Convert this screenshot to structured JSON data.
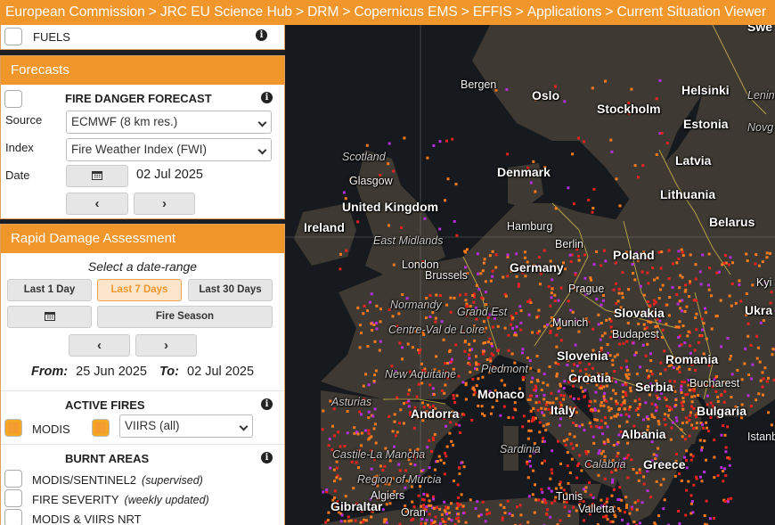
{
  "breadcrumb": [
    "European Commission",
    "JRC EU Science Hub",
    "DRM",
    "Copernicus EMS",
    "EFFIS",
    "Applications",
    "Current Situation Viewer"
  ],
  "fuels": {
    "label": "FUELS"
  },
  "forecasts": {
    "header": "Forecasts",
    "title": "FIRE DANGER FORECAST",
    "source_label": "Source",
    "source_value": "ECMWF (8 km res.)",
    "index_label": "Index",
    "index_value": "Fire Weather Index (FWI)",
    "date_label": "Date",
    "date_value": "02 Jul 2025",
    "prev": "‹",
    "next": "›"
  },
  "rda": {
    "header": "Rapid Damage Assessment",
    "select_range": "Select a date-range",
    "ranges": [
      "Last 1 Day",
      "Last 7 Days",
      "Last 30 Days"
    ],
    "active_range": "Last 7 Days",
    "fire_season": "Fire Season",
    "prev": "‹",
    "next": "›",
    "from_label": "From:",
    "from_value": "25 Jun 2025",
    "to_label": "To:",
    "to_value": "02 Jul 2025",
    "active_fires": {
      "title": "ACTIVE FIRES",
      "modis_label": "MODIS",
      "modis_checked": true,
      "viirs_checked": true,
      "viirs_value": "VIIRS (all)"
    },
    "burnt_areas": {
      "title": "BURNT AREAS",
      "items": [
        {
          "label": "MODIS/SENTINEL2",
          "note": "(supervised)"
        },
        {
          "label": "FIRE SEVERITY",
          "note": "(weekly updated)"
        },
        {
          "label": "MODIS & VIIRS NRT",
          "note": ""
        }
      ]
    }
  },
  "map": {
    "labels": [
      {
        "text": "Swe",
        "kind": "country"
      },
      {
        "text": "Bergen",
        "kind": "city"
      },
      {
        "text": "Oslo",
        "kind": "country"
      },
      {
        "text": "Helsinki",
        "kind": "country"
      },
      {
        "text": "Lenin",
        "kind": "region"
      },
      {
        "text": "Stockholm",
        "kind": "country"
      },
      {
        "text": "Estonia",
        "kind": "country"
      },
      {
        "text": "Novg",
        "kind": "region"
      },
      {
        "text": "Scotland",
        "kind": "region"
      },
      {
        "text": "Latvia",
        "kind": "country"
      },
      {
        "text": "Denmark",
        "kind": "country"
      },
      {
        "text": "Glasgow",
        "kind": "city"
      },
      {
        "text": "Lithuania",
        "kind": "country"
      },
      {
        "text": "United Kingdom",
        "kind": "country"
      },
      {
        "text": "Ireland",
        "kind": "country"
      },
      {
        "text": "Belarus",
        "kind": "country"
      },
      {
        "text": "Hamburg",
        "kind": "city"
      },
      {
        "text": "East Midlands",
        "kind": "region"
      },
      {
        "text": "Berlin",
        "kind": "city"
      },
      {
        "text": "London",
        "kind": "city"
      },
      {
        "text": "Poland",
        "kind": "country"
      },
      {
        "text": "Germany",
        "kind": "country"
      },
      {
        "text": "Brussels",
        "kind": "city"
      },
      {
        "text": "Kyi",
        "kind": "city"
      },
      {
        "text": "Prague",
        "kind": "city"
      },
      {
        "text": "Normandy",
        "kind": "region"
      },
      {
        "text": "Grand Est",
        "kind": "region"
      },
      {
        "text": "Slovakia",
        "kind": "country"
      },
      {
        "text": "Ukra",
        "kind": "country"
      },
      {
        "text": "Munich",
        "kind": "city"
      },
      {
        "text": "Centre-Val de Loire",
        "kind": "region"
      },
      {
        "text": "Budapest",
        "kind": "city"
      },
      {
        "text": "Romania",
        "kind": "country"
      },
      {
        "text": "Slovenia",
        "kind": "country"
      },
      {
        "text": "New Aquitaine",
        "kind": "region"
      },
      {
        "text": "Piedmont",
        "kind": "region"
      },
      {
        "text": "Croatia",
        "kind": "country"
      },
      {
        "text": "Bucharest",
        "kind": "city"
      },
      {
        "text": "Serbia",
        "kind": "country"
      },
      {
        "text": "Monaco",
        "kind": "country"
      },
      {
        "text": "Asturias",
        "kind": "region"
      },
      {
        "text": "Bulgaria",
        "kind": "country"
      },
      {
        "text": "Andorra",
        "kind": "country"
      },
      {
        "text": "Italy",
        "kind": "country"
      },
      {
        "text": "Istanbul",
        "kind": "city"
      },
      {
        "text": "Albania",
        "kind": "country"
      },
      {
        "text": "Sardinia",
        "kind": "region"
      },
      {
        "text": "Castile-La Mancha",
        "kind": "region"
      },
      {
        "text": "Calabria",
        "kind": "region"
      },
      {
        "text": "Greece",
        "kind": "country"
      },
      {
        "text": "Region of Murcia",
        "kind": "region"
      },
      {
        "text": "Algiers",
        "kind": "city"
      },
      {
        "text": "Tunis",
        "kind": "city"
      },
      {
        "text": "Gibraltar",
        "kind": "country"
      },
      {
        "text": "Oran",
        "kind": "city"
      },
      {
        "text": "Valletta",
        "kind": "city"
      }
    ],
    "colors": {
      "sea": "#16191d",
      "land": "#3e3a33",
      "border": "#d8c24a",
      "fire_orange": "#ff7a1a",
      "fire_red": "#e8231f",
      "fire_purple": "#b52ddc"
    }
  }
}
